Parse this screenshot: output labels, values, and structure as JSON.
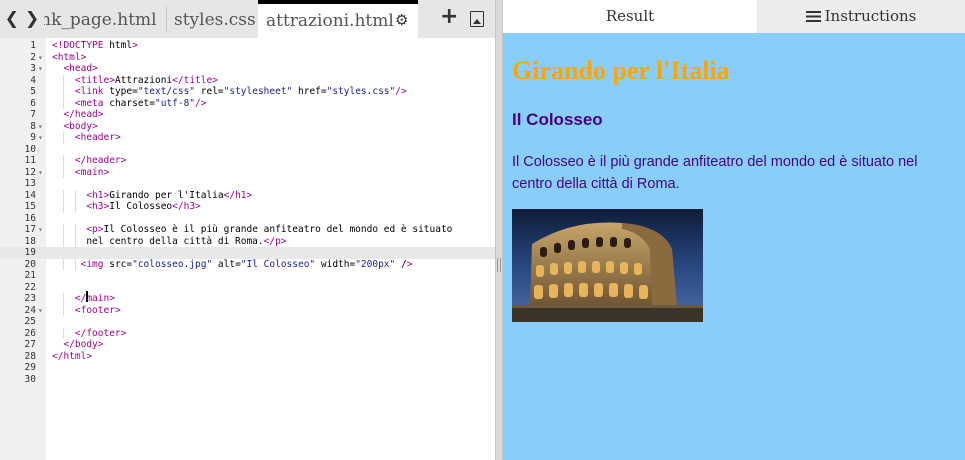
{
  "editor": {
    "nav": {
      "back": "❮",
      "forward": "❯"
    },
    "tabs": [
      {
        "label": "ank_page.html"
      },
      {
        "label": "styles.css"
      },
      {
        "label": "attrazioni.html"
      }
    ],
    "icons": {
      "settings": "gear-icon",
      "add": "plus-icon",
      "image": "image-icon"
    },
    "settings_glyph": "⚙",
    "add_glyph": "+",
    "code_lines": [
      {
        "n": "1",
        "fold": "",
        "code": "<!DOCTYPE html>"
      },
      {
        "n": "2",
        "fold": "▾",
        "code": "<html>"
      },
      {
        "n": "3",
        "fold": "▾",
        "code": "  <head>"
      },
      {
        "n": "4",
        "fold": "",
        "code": "    <title>Attrazioni</title>"
      },
      {
        "n": "5",
        "fold": "",
        "code": "    <link type=\"text/css\" rel=\"stylesheet\" href=\"styles.css\"/>"
      },
      {
        "n": "6",
        "fold": "",
        "code": "    <meta charset=\"utf-8\"/>"
      },
      {
        "n": "7",
        "fold": "",
        "code": "  </head>"
      },
      {
        "n": "8",
        "fold": "▾",
        "code": "  <body>"
      },
      {
        "n": "9",
        "fold": "▾",
        "code": "    <header>"
      },
      {
        "n": "10",
        "fold": "",
        "code": ""
      },
      {
        "n": "11",
        "fold": "",
        "code": "    </header>"
      },
      {
        "n": "12",
        "fold": "▾",
        "code": "    <main>"
      },
      {
        "n": "13",
        "fold": "",
        "code": ""
      },
      {
        "n": "14",
        "fold": "",
        "code": "      <h1>Girando per l'Italia</h1>"
      },
      {
        "n": "15",
        "fold": "",
        "code": "      <h3>Il Colosseo</h3>"
      },
      {
        "n": "16",
        "fold": "",
        "code": ""
      },
      {
        "n": "17",
        "fold": "▾",
        "code": "      <p>Il Colosseo è il più grande anfiteatro del mondo ed è situato"
      },
      {
        "n": "18",
        "fold": "",
        "code": "      nel centro della città di Roma.</p>"
      },
      {
        "n": "19",
        "fold": "",
        "code": ""
      },
      {
        "n": "20",
        "fold": "",
        "code": "     <img src=\"colosseo.jpg\" alt=\"Il Colosseo\" width=\"200px\" />"
      },
      {
        "n": "21",
        "fold": "",
        "code": ""
      },
      {
        "n": "22",
        "fold": "",
        "code": ""
      },
      {
        "n": "23",
        "fold": "",
        "code": "    </main>"
      },
      {
        "n": "24",
        "fold": "▾",
        "code": "    <footer>"
      },
      {
        "n": "25",
        "fold": "",
        "code": ""
      },
      {
        "n": "26",
        "fold": "",
        "code": "    </footer>"
      },
      {
        "n": "27",
        "fold": "",
        "code": "  </body>"
      },
      {
        "n": "28",
        "fold": "",
        "code": "</html>"
      },
      {
        "n": "29",
        "fold": "",
        "code": ""
      },
      {
        "n": "30",
        "fold": "",
        "code": ""
      }
    ],
    "active_line": "19"
  },
  "result": {
    "tab_result": "Result",
    "tab_instructions": "Instructions",
    "h1": "Girando per l'Italia",
    "h3": "Il Colosseo",
    "paragraph": "Il Colosseo è il più grande anfiteatro del mondo ed è situato nel centro della città di Roma.",
    "image_alt": "Il Colosseo",
    "background": "#87cefa",
    "h1_color": "#ffa500",
    "text_color": "#4b0082"
  }
}
